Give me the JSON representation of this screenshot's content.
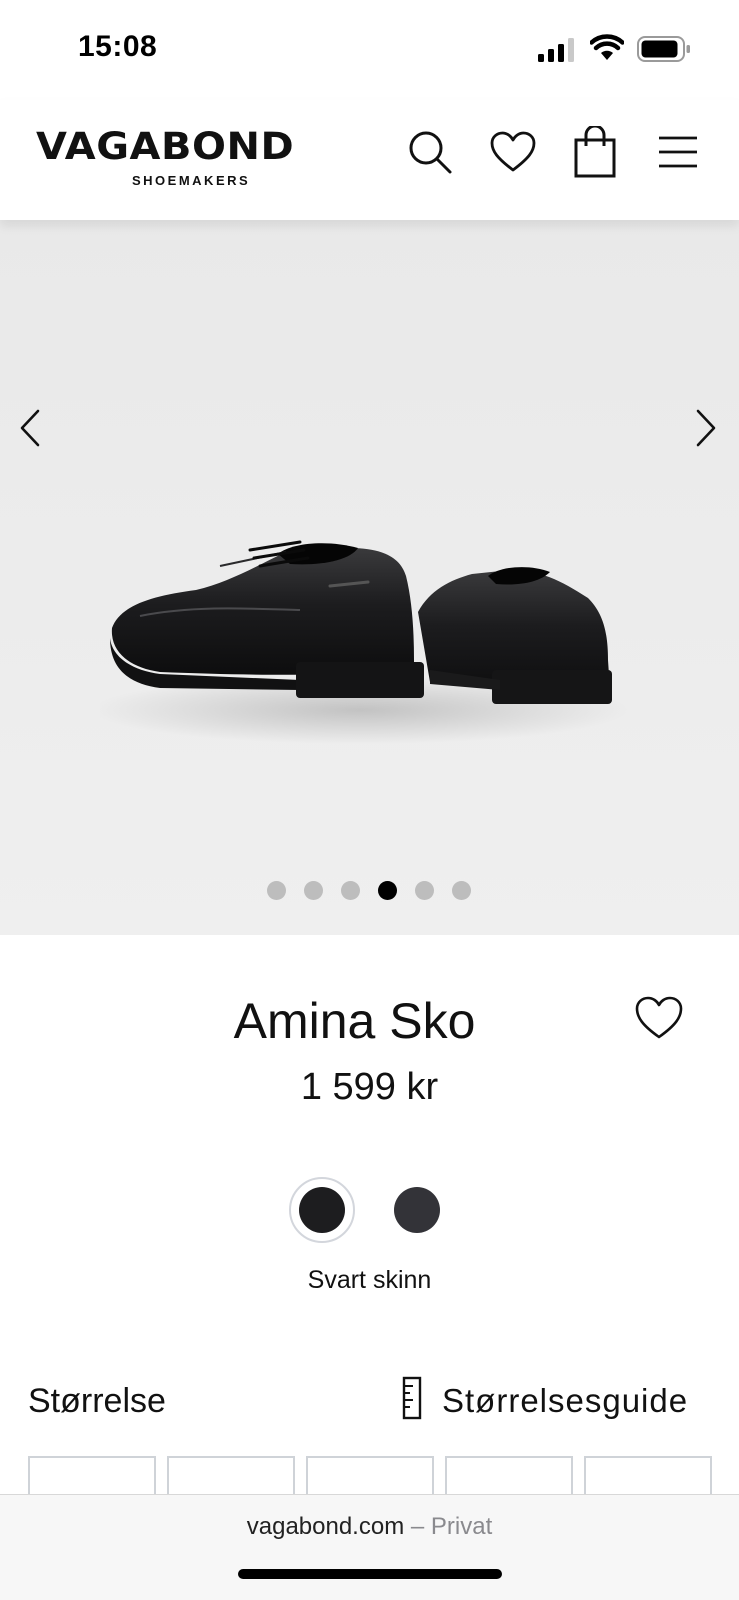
{
  "status_bar": {
    "time": "15:08"
  },
  "header": {
    "logo_main": "VAGABOND",
    "logo_sub": "SHOEMAKERS",
    "icons": [
      "search-icon",
      "heart-icon",
      "shopping-bag-icon",
      "hamburger-menu-icon"
    ]
  },
  "gallery": {
    "image_count": 6,
    "active_index": 3,
    "prev_icon": "chevron-left-icon",
    "next_icon": "chevron-right-icon"
  },
  "product": {
    "title": "Amina Sko",
    "price": "1 599 kr",
    "selected_color_label": "Svart skinn",
    "colors": [
      {
        "hex": "#1d1d1f",
        "selected": true
      },
      {
        "hex": "#333338",
        "selected": false
      }
    ]
  },
  "size": {
    "heading": "Størrelse",
    "guide_label": "Størrelsesguide"
  },
  "browser": {
    "domain": "vagabond.com",
    "mode": "– Privat"
  }
}
